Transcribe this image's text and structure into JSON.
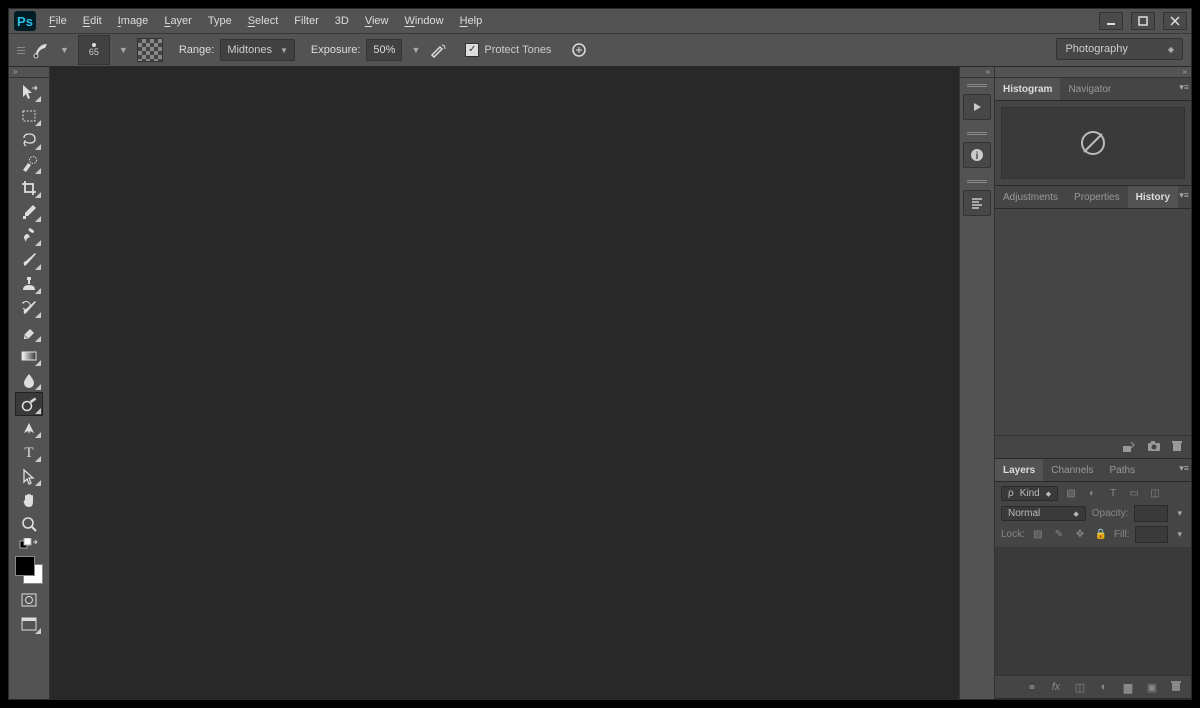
{
  "app": {
    "name": "Adobe Photoshop"
  },
  "menu": [
    "File",
    "Edit",
    "Image",
    "Layer",
    "Type",
    "Select",
    "Filter",
    "3D",
    "View",
    "Window",
    "Help"
  ],
  "options": {
    "brush_size": "65",
    "range_label": "Range:",
    "range_value": "Midtones",
    "exposure_label": "Exposure:",
    "exposure_value": "50%",
    "protect_tones_label": "Protect Tones",
    "protect_tones_checked": true
  },
  "workspace": {
    "current": "Photography"
  },
  "tools": [
    {
      "name": "move-tool"
    },
    {
      "name": "rectangular-marquee-tool"
    },
    {
      "name": "lasso-tool"
    },
    {
      "name": "quick-selection-tool"
    },
    {
      "name": "crop-tool"
    },
    {
      "name": "eyedropper-tool"
    },
    {
      "name": "spot-healing-brush-tool"
    },
    {
      "name": "brush-tool"
    },
    {
      "name": "clone-stamp-tool"
    },
    {
      "name": "history-brush-tool"
    },
    {
      "name": "eraser-tool"
    },
    {
      "name": "gradient-tool"
    },
    {
      "name": "blur-tool"
    },
    {
      "name": "dodge-tool",
      "selected": true
    },
    {
      "name": "pen-tool"
    },
    {
      "name": "horizontal-type-tool"
    },
    {
      "name": "path-selection-tool"
    },
    {
      "name": "rectangle-tool"
    },
    {
      "name": "hand-tool"
    },
    {
      "name": "zoom-tool"
    },
    {
      "name": "default-fg-bg"
    }
  ],
  "panels": {
    "histogram_group": {
      "tabs": [
        "Histogram",
        "Navigator"
      ],
      "active": "Histogram"
    },
    "history_group": {
      "tabs": [
        "Adjustments",
        "Properties",
        "History"
      ],
      "active": "History"
    },
    "layers_group": {
      "tabs": [
        "Layers",
        "Channels",
        "Paths"
      ],
      "active": "Layers",
      "kind": "Kind",
      "blend": "Normal",
      "opacity_label": "Opacity:",
      "lock_label": "Lock:",
      "fill_label": "Fill:"
    }
  }
}
